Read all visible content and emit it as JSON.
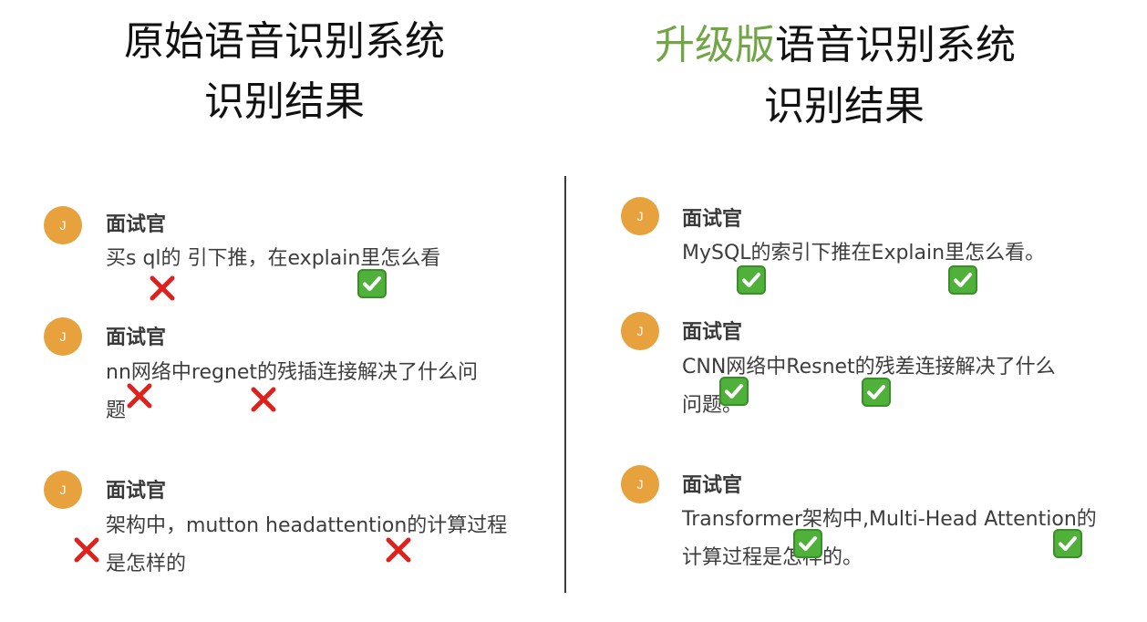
{
  "left_panel": {
    "title_line1": "原始语音识别系统",
    "title_line2": "识别结果",
    "messages": [
      {
        "avatar": "J",
        "speaker": "面试官",
        "text": "买s ql的 引下推，在explain里怎么看"
      },
      {
        "avatar": "J",
        "speaker": "面试官",
        "text": "nn网络中regnet的残插连接解决了什么问\n题"
      },
      {
        "avatar": "J",
        "speaker": "面试官",
        "text": "架构中，mutton headattention的计算过程\n是怎样的"
      }
    ]
  },
  "right_panel": {
    "title_accent": "升级版",
    "title_rest": "语音识别系统",
    "title_line2": "识别结果",
    "messages": [
      {
        "avatar": "J",
        "speaker": "面试官",
        "text": "MySQL的索引下推在Explain里怎么看。"
      },
      {
        "avatar": "J",
        "speaker": "面试官",
        "text": "CNN网络中Resnet的残差连接解决了什么\n问题。"
      },
      {
        "avatar": "J",
        "speaker": "面试官",
        "text": "Transformer架构中,Multi-Head Attention的\n计算过程是怎样的。"
      }
    ]
  },
  "marks": {
    "wrong_icon": "red-cross",
    "correct_icon": "green-check-box",
    "colors": {
      "wrong": "#e0201b",
      "correct": "#4fb13a",
      "accent": "#71a647",
      "avatar": "#e7a13d"
    }
  }
}
